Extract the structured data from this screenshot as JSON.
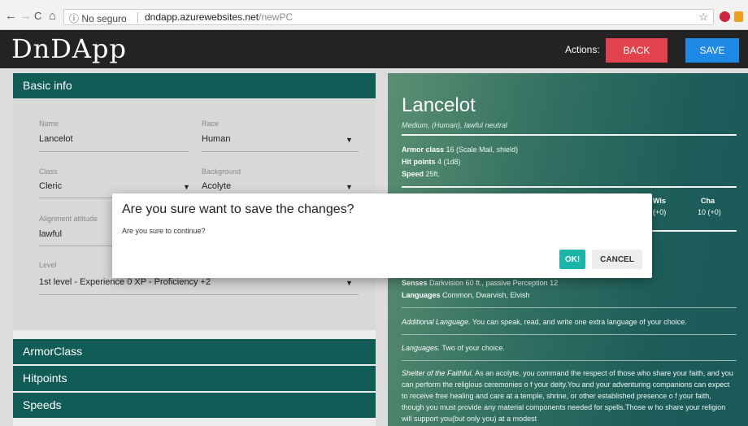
{
  "browser": {
    "url_prefix": "No seguro",
    "url_host": "dndapp.azurewebsites.net",
    "url_path": "/newPC",
    "back_icon": "←",
    "forward_icon": "→",
    "reload_icon": "C",
    "home_icon": "⌂",
    "info_icon": "ⓘ",
    "star_icon": "☆",
    "menu_icon": "⋮"
  },
  "header": {
    "logo": "DnDApp",
    "actions_label": "Actions:",
    "back_label": "BACK",
    "save_label": "SAVE"
  },
  "left_panel": {
    "basic_info_title": "Basic info",
    "fields": {
      "name": {
        "label": "Name",
        "value": "Lancelot"
      },
      "race": {
        "label": "Race",
        "value": "Human"
      },
      "class": {
        "label": "Class",
        "value": "Cleric"
      },
      "background": {
        "label": "Background",
        "value": "Acolyte"
      },
      "alignment_attitude": {
        "label": "Alignment attitude",
        "value": "lawful"
      },
      "level": {
        "label": "Level",
        "value": "1st level - Experience 0 XP - Proficiency +2"
      }
    },
    "caret": "▼",
    "sections": [
      "ArmorClass",
      "Hitpoints",
      "Speeds"
    ]
  },
  "stat_block": {
    "name": "Lancelot",
    "subtitle": "Medium, (Human), lawful neutral",
    "armor_class_label": "Armor class",
    "armor_class_value": "16 (Scale Mail, shield)",
    "hit_points_label": "Hit points",
    "hit_points_value": "4 (1d8)",
    "speed_label": "Speed",
    "speed_value": "25ft.",
    "wis_head": "Wis",
    "wis_val": "(+0)",
    "cha_head": "Cha",
    "cha_val": "10 (+0)",
    "senses_label": "Senses",
    "senses_value": "Darkvision 60 ft., passive Perception 12",
    "languages_label": "Languages",
    "languages_value": "Common, Dwarvish, Elvish",
    "additional_language_title": "Additional Language.",
    "additional_language_text": "You can speak, read, and write one extra language of your choice.",
    "languages2_title": "Languages.",
    "languages2_text": "Two of your choice.",
    "shelter_title": "Shelter of the Faithful.",
    "shelter_text": "As an acolyte, you command the respect of those who share your faith, and you can perform the religious ceremonies o f your deity.You and your adventuring companions can expect to receive free healing and care at a temple, shrine, or other established presence o f your faith, though you must provide any material components needed for spells.Those w ho share your religion will support you(but only you) at a modest"
  },
  "dialog": {
    "title": "Are you sure want to save the changes?",
    "text": "Are you sure to continue?",
    "ok_label": "OK!",
    "cancel_label": "CANCEL"
  }
}
